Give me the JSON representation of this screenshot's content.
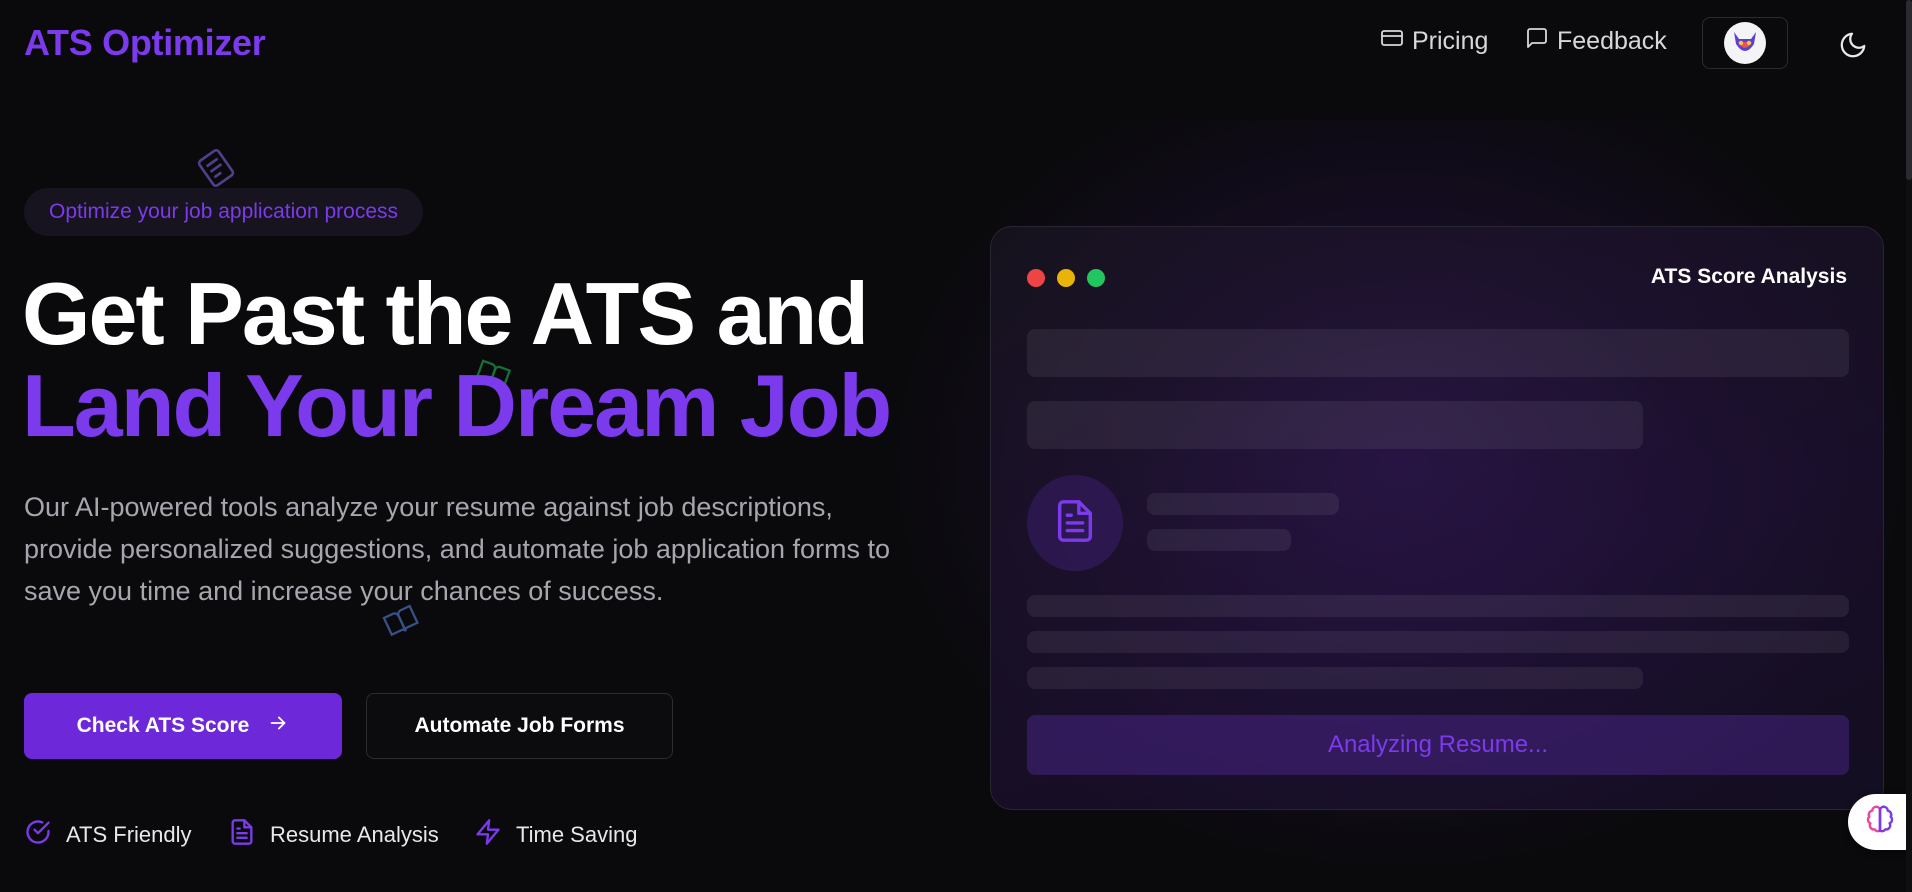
{
  "header": {
    "logo": "ATS Optimizer",
    "nav": [
      {
        "label": "Pricing",
        "icon": "credit-card-icon"
      },
      {
        "label": "Feedback",
        "icon": "message-square-icon"
      }
    ],
    "theme_icon": "moon-icon"
  },
  "hero": {
    "badge": "Optimize your job application process",
    "headline_line1": "Get Past the ATS and",
    "headline_line2": "Land Your Dream Job",
    "description": "Our AI-powered tools analyze your resume against job descriptions, provide personalized suggestions, and automate job application forms to save you time and increase your chances of success.",
    "primary_button": "Check ATS Score",
    "secondary_button": "Automate Job Forms",
    "features": [
      {
        "label": "ATS Friendly",
        "icon": "check-circle-icon"
      },
      {
        "label": "Resume Analysis",
        "icon": "file-text-icon"
      },
      {
        "label": "Time Saving",
        "icon": "zap-icon"
      }
    ]
  },
  "card": {
    "title": "ATS Score Analysis",
    "status": "Analyzing Resume...",
    "window_dots": [
      "#ef4444",
      "#eab308",
      "#22c55e"
    ]
  },
  "colors": {
    "accent": "#7c3aed",
    "button": "#6d28d9",
    "background": "#0a0a0c"
  }
}
